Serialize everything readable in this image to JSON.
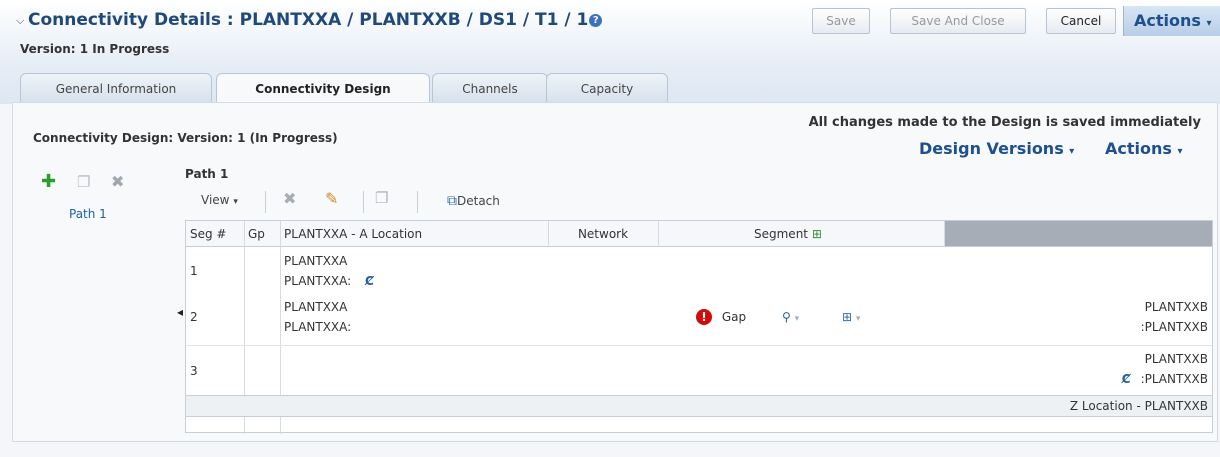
{
  "header": {
    "title": "Connectivity Details : PLANTXXA / PLANTXXB / DS1 / T1 / 1",
    "version": "Version: 1 In Progress",
    "buttons": {
      "save": "Save",
      "save_close": "Save And Close",
      "cancel": "Cancel",
      "actions": "Actions"
    }
  },
  "tabs": [
    "General Information",
    "Connectivity Design",
    "Channels",
    "Capacity"
  ],
  "design": {
    "title": "Connectivity Design: Version: 1 (In Progress)",
    "note": "All changes made to the Design is saved immediately",
    "design_versions": "Design Versions",
    "actions": "Actions"
  },
  "paths": {
    "items": [
      "Path 1"
    ]
  },
  "path": {
    "label": "Path 1",
    "toolbar": {
      "view": "View",
      "detach": "Detach"
    },
    "columns": {
      "seg": "Seg #",
      "gp": "Gp",
      "a_location": "PLANTXXA - A Location",
      "network": "Network",
      "segment": "Segment"
    },
    "rows": [
      {
        "seg": "1",
        "a1": "PLANTXXA",
        "a2": "PLANTXXA:"
      },
      {
        "seg": "2",
        "a1": "PLANTXXA",
        "a2": "PLANTXXA:",
        "gap": "Gap",
        "z1": "PLANTXXB",
        "z2": ":PLANTXXB"
      },
      {
        "seg": "3",
        "z1": "PLANTXXB",
        "z2": ":PLANTXXB"
      }
    ],
    "footer_z": "Z Location - PLANTXXB"
  }
}
